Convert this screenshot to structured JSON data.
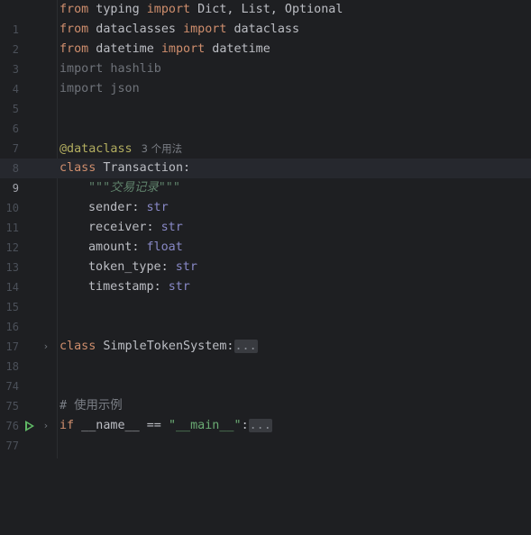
{
  "editor": {
    "lines": {
      "l1": {
        "num": "1",
        "t1": "from",
        "t2": " typing ",
        "t3": "import",
        "t4": " Dict, List, Optional"
      },
      "l2": {
        "num": "2",
        "t1": "from",
        "t2": " dataclasses ",
        "t3": "import",
        "t4": " dataclass"
      },
      "l3": {
        "num": "3",
        "t1": "from",
        "t2": " datetime ",
        "t3": "import",
        "t4": " datetime"
      },
      "l4": {
        "num": "4",
        "t1": "import hashlib"
      },
      "l5": {
        "num": "5",
        "t1": "import json"
      },
      "l6": {
        "num": "6"
      },
      "l7": {
        "num": "7"
      },
      "l8": {
        "num": "8",
        "t1": "@dataclass",
        "hint": "3 个用法"
      },
      "l9": {
        "num": "9",
        "t1": "class",
        "t2": " Transaction:"
      },
      "l10": {
        "num": "10",
        "t1": "\"\"\"交易记录\"\"\""
      },
      "l11": {
        "num": "11",
        "t1": "sender",
        "t2": ": ",
        "t3": "str"
      },
      "l12": {
        "num": "12",
        "t1": "receiver",
        "t2": ": ",
        "t3": "str"
      },
      "l13": {
        "num": "13",
        "t1": "amount",
        "t2": ": ",
        "t3": "float"
      },
      "l14": {
        "num": "14",
        "t1": "token_type",
        "t2": ": ",
        "t3": "str"
      },
      "l15": {
        "num": "15",
        "t1": "timestamp",
        "t2": ": ",
        "t3": "str"
      },
      "l16": {
        "num": "16"
      },
      "l17": {
        "num": "17"
      },
      "l18": {
        "num": "18",
        "t1": "class",
        "t2": " SimpleTokenSystem:",
        "fold": "..."
      },
      "l74": {
        "num": "74"
      },
      "l75": {
        "num": "75"
      },
      "l76": {
        "num": "76",
        "t1": "# 使用示例"
      },
      "l77": {
        "num": "77",
        "t1": "if",
        "t2": " __name__ == ",
        "t3": "\"__main__\"",
        "t4": ":",
        "fold": "..."
      }
    },
    "icons": {
      "chevron": "›"
    },
    "colors": {
      "background": "#1e1f22",
      "keyword": "#cf8e6d",
      "decorator": "#b3ae60",
      "builtin": "#8888c6",
      "string": "#6aab73",
      "docstring": "#5f826b",
      "comment": "#7a7e85",
      "run": "#5fb865"
    }
  }
}
